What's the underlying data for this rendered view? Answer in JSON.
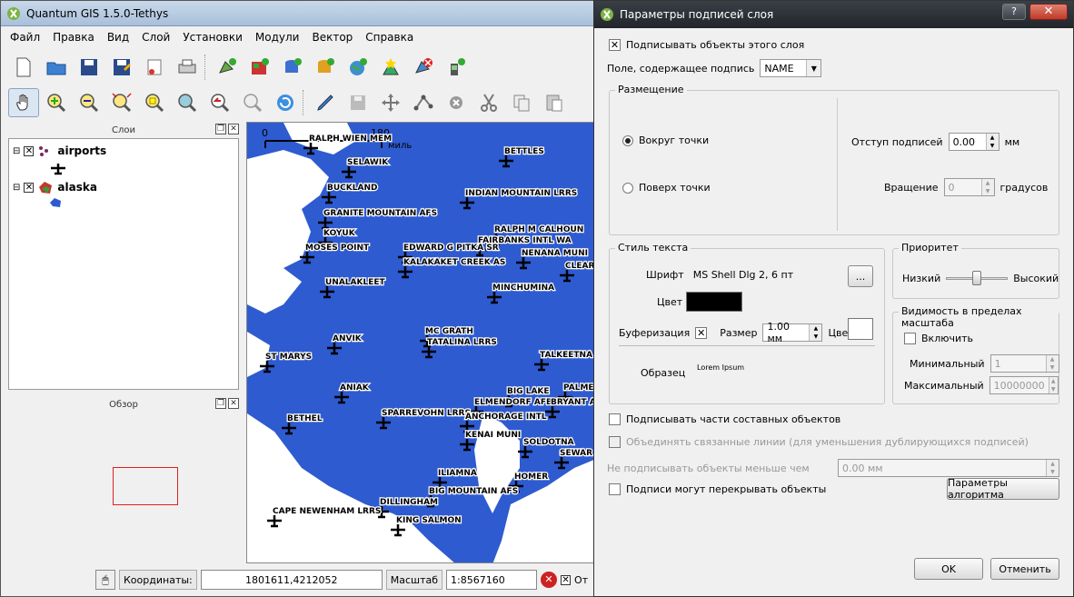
{
  "app": {
    "title": "Quantum GIS 1.5.0-Tethys",
    "menu": [
      "Файл",
      "Правка",
      "Вид",
      "Слой",
      "Установки",
      "Модули",
      "Вектор",
      "Справка"
    ]
  },
  "layers_panel": {
    "title": "Слои",
    "layers": [
      {
        "name": "airports",
        "checked": true
      },
      {
        "name": "alaska",
        "checked": true
      }
    ]
  },
  "overview_panel": {
    "title": "Обзор"
  },
  "map": {
    "scale_bar": {
      "start": "0",
      "end": "180",
      "unit": "миль"
    },
    "labels": [
      "RALPH WIEN MEM",
      "SELAWIK",
      "BETTLES",
      "BUCKLAND",
      "INDIAN MOUNTAIN LRRS",
      "GRANITE MOUNTAIN AFS",
      "RALPH M CALHOUN",
      "KOYUK",
      "FAIRBANKS INTL WA",
      "MOSES POINT",
      "EDWARD G PITKA SR",
      "NENANA MUNI",
      "KALAKAKET CREEK AS",
      "CLEAR",
      "UNALAKLEET",
      "MINCHUMINA",
      "MC GRATH",
      "ANVIK",
      "TATALINA LRRS",
      "ST MARYS",
      "TALKEETNA",
      "ANIAK",
      "BIG LAKE",
      "PALME",
      "ELMENDORF AFB",
      "BRYANT A",
      "BETHEL",
      "SPARREVOHN LRRS",
      "ANCHORAGE INTL",
      "KENAI MUNI",
      "SOLDOTNA",
      "SEWAR",
      "ILIAMNA",
      "HOMER",
      "BIG MOUNTAIN AFS",
      "DILLINGHAM",
      "CAPE NEWENHAM LRRS",
      "KING SALMON"
    ]
  },
  "statusbar": {
    "coords_label": "Координаты:",
    "coords_value": "1801611,4212052",
    "scale_label": "Масштаб",
    "scale_value": "1:8567160",
    "render_label": "От"
  },
  "dialog": {
    "title": "Параметры подписей слоя",
    "help_btn": "?",
    "label_this_layer": "Подписывать объекты этого слоя",
    "field_label": "Поле, содержащее подпись",
    "field_value": "NAME",
    "placement": {
      "title": "Размещение",
      "around_point": "Вокруг точки",
      "over_point": "Поверх точки",
      "offset_label": "Отступ подписей",
      "offset_value": "0.00",
      "offset_unit": "мм",
      "rotation_label": "Вращение",
      "rotation_value": "0",
      "rotation_unit": "градусов"
    },
    "text_style": {
      "title": "Стиль текста",
      "font_label": "Шрифт",
      "font_value": "MS Shell Dlg 2, 6 пт",
      "font_btn": "...",
      "color_label": "Цвет",
      "color": "#000000",
      "buffer_label": "Буферизация",
      "size_label": "Размер",
      "size_value": "1.00 мм",
      "buffer_color_label": "Цвет",
      "buffer_color": "#ffffff",
      "sample_label": "Образец",
      "sample_text": "Lorem Ipsum"
    },
    "priority": {
      "title": "Приоритет",
      "low": "Низкий",
      "high": "Высокий",
      "level": 0.5
    },
    "scale_visibility": {
      "title": "Видимость в пределах масштаба",
      "enable": "Включить",
      "min_label": "Минимальный",
      "min_value": "1",
      "max_label": "Максимальный",
      "max_value": "10000000"
    },
    "label_parts": "Подписывать части составных объектов",
    "merge_lines": "Объединять связанные линии (для уменьшения дублирующихся подписей)",
    "min_size_label": "Не подписывать объекты меньше чем",
    "min_size_value": "0.00 мм",
    "overlap": "Подписи могут перекрывать объекты",
    "engine_btn": "Параметры алгоритма",
    "ok": "OK",
    "cancel": "Отменить"
  },
  "colors": {
    "water": "#ffffff",
    "land": "#2e5bd0",
    "overview_extent": "#e02020"
  }
}
